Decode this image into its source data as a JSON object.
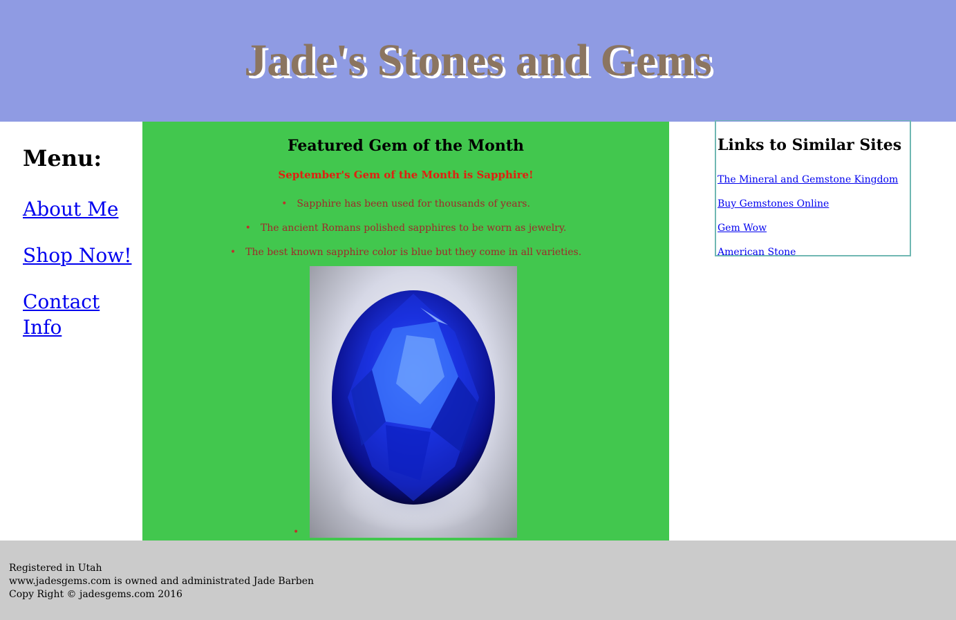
{
  "header": {
    "title": "Jade's Stones and Gems",
    "background": "#8f9be3",
    "title_color": "#8b7560"
  },
  "menu": {
    "heading": "Menu:",
    "items": [
      {
        "label": "About Me"
      },
      {
        "label": "Shop Now!"
      },
      {
        "label": "Contact Info"
      }
    ]
  },
  "main": {
    "background": "#42c74e",
    "heading": "Featured Gem of the Month",
    "intro": "September's Gem of the Month is Sapphire!",
    "facts": [
      "Sapphire has been used for thousands of years.",
      "The ancient Romans polished sapphires to be worn as jewelry.",
      "The best known sapphire color is blue but they come in all varieties."
    ],
    "image_icon": "sapphire-gem-image"
  },
  "links": {
    "heading": "Links to Similar Sites",
    "items": [
      {
        "label": "The Mineral and Gemstone Kingdom"
      },
      {
        "label": "Buy Gemstones Online"
      },
      {
        "label": "Gem Wow"
      },
      {
        "label": "American Stone"
      }
    ]
  },
  "footer": {
    "lines": [
      "Registered in Utah",
      "www.jadesgems.com is owned and administrated Jade Barben",
      "Copy Right © jadesgems.com 2016"
    ]
  }
}
